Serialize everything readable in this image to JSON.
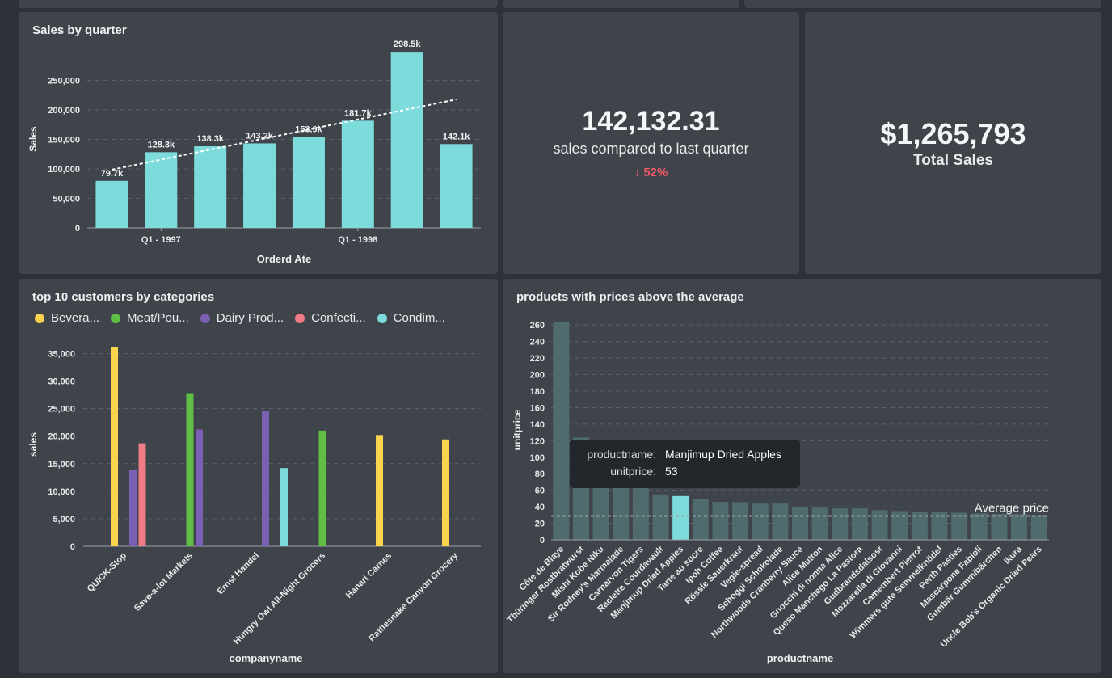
{
  "colors": {
    "background": "#2d3238",
    "card": "#3f444b",
    "teal": "#7ddcdb",
    "yellow": "#fcd34d",
    "green": "#5fbf45",
    "purple": "#7b5fb2",
    "red": "#ef5a6a",
    "product_bar": "#4f6b6e"
  },
  "sales_by_quarter": {
    "title": "Sales by quarter",
    "chart_data": {
      "type": "bar",
      "categories": [
        "",
        "Q1 - 1997",
        "",
        "",
        "",
        "Q1 - 1998",
        "",
        ""
      ],
      "values": [
        79700,
        128300,
        138300,
        143200,
        153900,
        181700,
        298500,
        142100
      ],
      "data_labels": [
        "79.7k",
        "128.3k",
        "138.3k",
        "143.2k",
        "153.9k",
        "181.7k",
        "298.5k",
        "142.1k"
      ],
      "yticks": [
        "0",
        "50,000",
        "100,000",
        "150,000",
        "200,000",
        "250,000"
      ],
      "ylim": [
        0,
        300000
      ],
      "xlabel": "Orderd Ate",
      "ylabel": "Sales",
      "trendline": true,
      "grid": true
    }
  },
  "quarter_compare": {
    "value": "142,132.31",
    "label": "sales compared to last quarter",
    "delta_icon": "arrow-down-icon",
    "delta": "52%"
  },
  "total_sales": {
    "value": "$1,265,793",
    "label": "Total Sales"
  },
  "top_customers": {
    "title": "top 10 customers by categories",
    "legend": [
      {
        "name": "Bevera...",
        "color": "#fcd34d"
      },
      {
        "name": "Meat/Pou...",
        "color": "#5fbf45"
      },
      {
        "name": "Dairy Prod...",
        "color": "#7b5fb2"
      },
      {
        "name": "Confecti...",
        "color": "#ef7b86"
      },
      {
        "name": "Condim...",
        "color": "#7ddcdb"
      }
    ],
    "chart_data": {
      "type": "bar",
      "categories": [
        "QUICK-Stop",
        "Save-a-lot Markets",
        "Ernst Handel",
        "Hungry Owl All-Night Grocers",
        "Hanari Carnes",
        "Rattlesnake Canyon Grocery"
      ],
      "series": [
        {
          "name": "Bevera...",
          "values": [
            36200,
            null,
            null,
            null,
            20200,
            19400
          ]
        },
        {
          "name": "Meat/Pou...",
          "values": [
            null,
            27800,
            null,
            21000,
            null,
            null
          ]
        },
        {
          "name": "Dairy Prod...",
          "values": [
            13900,
            21200,
            24600,
            null,
            null,
            null
          ]
        },
        {
          "name": "Confecti...",
          "values": [
            18700,
            null,
            null,
            null,
            null,
            null
          ]
        },
        {
          "name": "Condim...",
          "values": [
            null,
            null,
            14200,
            null,
            null,
            null
          ]
        }
      ],
      "yticks": [
        "0",
        "5,000",
        "10,000",
        "15,000",
        "20,000",
        "25,000",
        "30,000",
        "35,000"
      ],
      "ylim": [
        0,
        38000
      ],
      "xlabel": "companyname",
      "ylabel": "sales",
      "grid": true
    }
  },
  "products_above_avg": {
    "title": "products with prices above the average",
    "chart_data": {
      "type": "bar",
      "categories": [
        "Côte de Blaye",
        "Thüringer Rostbratwurst",
        "Mishi Kobe Niku",
        "Sir Rodney's Marmalade",
        "Carnarvon Tigers",
        "Raclette Courdavault",
        "Manjimup Dried Apples",
        "Tarte au sucre",
        "Ipoh Coffee",
        "Rössle Sauerkraut",
        "Vegie-spread",
        "Schoggi Schokolade",
        "Northwoods Cranberry Sauce",
        "Alice Mutton",
        "Gnocchi di nonna Alice",
        "Queso Manchego La Pastora",
        "Gudbrandsdalsost",
        "Mozzarella di Giovanni",
        "Camembert Pierrot",
        "Wimmers gute Semmelknödel",
        "Perth Pasties",
        "Mascarpone Fabioli",
        "Gumbär Gummibärchen",
        "Ikura",
        "Uncle Bob's Organic Dried Pears"
      ],
      "values": [
        263.5,
        123.79,
        97,
        81,
        62.5,
        55,
        53,
        49.3,
        46,
        45.6,
        43.9,
        43.9,
        40,
        39,
        38,
        38,
        36,
        34.8,
        34,
        33.25,
        32.8,
        32,
        31.23,
        31,
        30
      ],
      "highlight_index": 6,
      "yticks": [
        "0",
        "20",
        "40",
        "60",
        "80",
        "100",
        "120",
        "140",
        "160",
        "180",
        "200",
        "220",
        "240",
        "260"
      ],
      "ylim": [
        0,
        270
      ],
      "xlabel": "productname",
      "ylabel": "unitprice",
      "average_line": 28.87,
      "average_label": "Average price",
      "grid": true
    },
    "tooltip": {
      "key1": "productname:",
      "val1": "Manjimup Dried Apples",
      "key2": "unitprice:",
      "val2": "53"
    }
  }
}
